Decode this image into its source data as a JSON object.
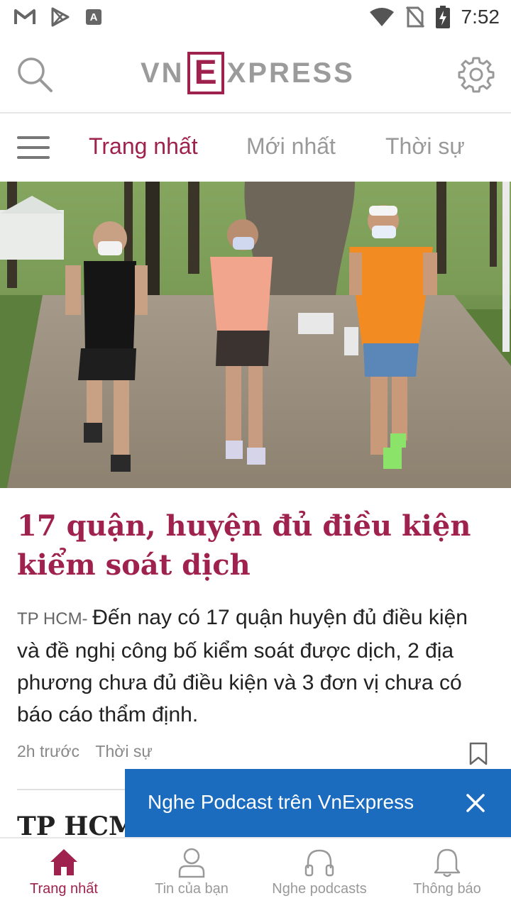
{
  "status_bar": {
    "time": "7:52",
    "left_icons": [
      "gmail-icon",
      "play-store-icon",
      "accessibility-icon"
    ],
    "right_icons": [
      "wifi-icon",
      "no-sim-icon",
      "battery-charging-icon"
    ]
  },
  "header": {
    "logo_left": "VN",
    "logo_e": "E",
    "logo_right": "XPRESS",
    "brand_color": "#9f224e"
  },
  "tabs": [
    {
      "label": "Trang nhất",
      "active": true
    },
    {
      "label": "Mới nhất",
      "active": false
    },
    {
      "label": "Thời sự",
      "active": false
    }
  ],
  "article": {
    "title": "17 quận, huyện đủ điều kiện kiểm soát dịch",
    "location": "TP HCM- ",
    "lead": "Đến nay có 17 quận huyện đủ điều kiện và đề nghị công bố kiểm soát được dịch, 2 địa phương chưa đủ điều kiện và 3 đơn vị chưa có báo cáo thẩm định.",
    "time": "2h trước",
    "category": "Thời sự"
  },
  "next_article": {
    "title_partial": "TP HCM"
  },
  "podcast_toast": {
    "text": "Nghe Podcast trên VnExpress",
    "color": "#1b6bbf"
  },
  "bottom_nav": [
    {
      "label": "Trang nhất",
      "icon": "home-icon",
      "active": true
    },
    {
      "label": "Tin của bạn",
      "icon": "user-icon",
      "active": false
    },
    {
      "label": "Nghe podcasts",
      "icon": "headphones-icon",
      "active": false
    },
    {
      "label": "Thông báo",
      "icon": "bell-icon",
      "active": false
    }
  ]
}
